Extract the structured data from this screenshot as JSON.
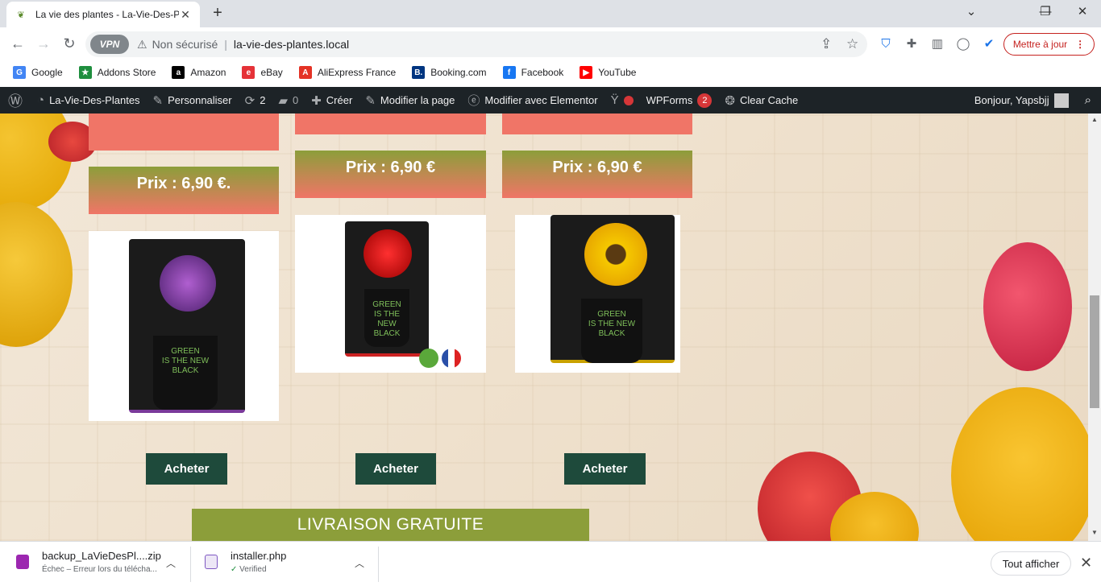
{
  "browser": {
    "tab_title": "La vie des plantes - La-Vie-Des-P",
    "tab_close": "✕",
    "new_tab": "+",
    "window_controls": [
      "⌄",
      "—",
      "❐",
      "✕"
    ],
    "vpn_label": "VPN",
    "security_label": "Non sécurisé",
    "url": "la-vie-des-plantes.local",
    "update_label": "Mettre à jour",
    "update_menu": "⋮"
  },
  "bookmarks": [
    {
      "label": "Google",
      "icon": "google-icon",
      "color": "#4285f4",
      "glyph": "G"
    },
    {
      "label": "Addons Store",
      "icon": "addons-store-icon",
      "color": "#1e8e3e",
      "glyph": "★"
    },
    {
      "label": "Amazon",
      "icon": "amazon-icon",
      "color": "#000000",
      "glyph": "a"
    },
    {
      "label": "eBay",
      "icon": "ebay-icon",
      "color": "#e53238",
      "glyph": "e"
    },
    {
      "label": "AliExpress France",
      "icon": "aliexpress-icon",
      "color": "#e43225",
      "glyph": "A"
    },
    {
      "label": "Booking.com",
      "icon": "booking-icon",
      "color": "#003580",
      "glyph": "B."
    },
    {
      "label": "Facebook",
      "icon": "facebook-icon",
      "color": "#1877f2",
      "glyph": "f"
    },
    {
      "label": "YouTube",
      "icon": "youtube-icon",
      "color": "#ff0000",
      "glyph": "▶"
    }
  ],
  "wp_admin_bar": {
    "site_name": "La-Vie-Des-Plantes",
    "customize": "Personnaliser",
    "updates_count": "2",
    "comments_count": "0",
    "create": "Créer",
    "edit_page": "Modifier la page",
    "elementor": "Modifier avec Elementor",
    "wpforms": "WPForms",
    "wpforms_count": "2",
    "clear_cache": "Clear Cache",
    "greeting": "Bonjour, Yapsbjj"
  },
  "products": [
    {
      "price": "Prix : 6,90 €.",
      "buy_label": "Acheter",
      "flower_color": "#6b2f8f"
    },
    {
      "price": "Prix : 6,90 €",
      "buy_label": "Acheter",
      "flower_color": "#d1202a"
    },
    {
      "price": "Prix : 6,90 €",
      "buy_label": "Acheter",
      "flower_color": "#f2c313"
    }
  ],
  "pot_text": "GREEN\nIS THE NEW\nBLACK",
  "livraison": "LIVRAISON GRATUITE",
  "downloads": [
    {
      "name": "backup_LaVieDesPl....zip",
      "status": "Échec – Erreur lors du téléchа...",
      "icon": "zip-file-icon",
      "color": "#9c27b0"
    },
    {
      "name": "installer.php",
      "status": "Verified",
      "icon": "php-file-icon",
      "color": "#7e57c2"
    }
  ],
  "show_all": "Tout afficher",
  "colors": {
    "accent_green": "#8c9e3a",
    "salmon": "#f07567",
    "button_dark": "#1e4a3b",
    "wp_bar": "#1d2327"
  }
}
